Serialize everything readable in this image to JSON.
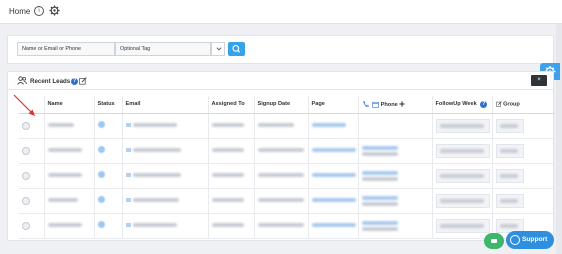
{
  "topbar": {
    "title": "Home",
    "info_glyph": "i"
  },
  "search": {
    "name_placeholder": "Name or Email or Phone",
    "tag_placeholder": "Optional Tag"
  },
  "leads": {
    "title": "Recent Leads",
    "help_glyph": "?",
    "close_glyph": "×",
    "columns": {
      "name": "Name",
      "status": "Status",
      "email": "Email",
      "assigned_to": "Assigned To",
      "signup_date": "Signup Date",
      "page": "Page",
      "phone": "Phone",
      "followup_week": "FollowUp Week",
      "group": "Group"
    },
    "followup_help_glyph": "?"
  },
  "support": {
    "label": "Support"
  },
  "colors": {
    "accent": "#36a3e9",
    "annotation_arrow": "#e0322f",
    "support": "#2e8fe0",
    "chat_green": "#3fb66b",
    "close_dark": "#2f3438"
  },
  "icons": [
    "info-icon",
    "gear-icon",
    "chevron-down-icon",
    "search-icon",
    "users-icon",
    "help-icon",
    "edit-icon",
    "close-icon",
    "phone-icon",
    "calendar-icon",
    "plus-icon",
    "support-icon",
    "chat-icon"
  ]
}
